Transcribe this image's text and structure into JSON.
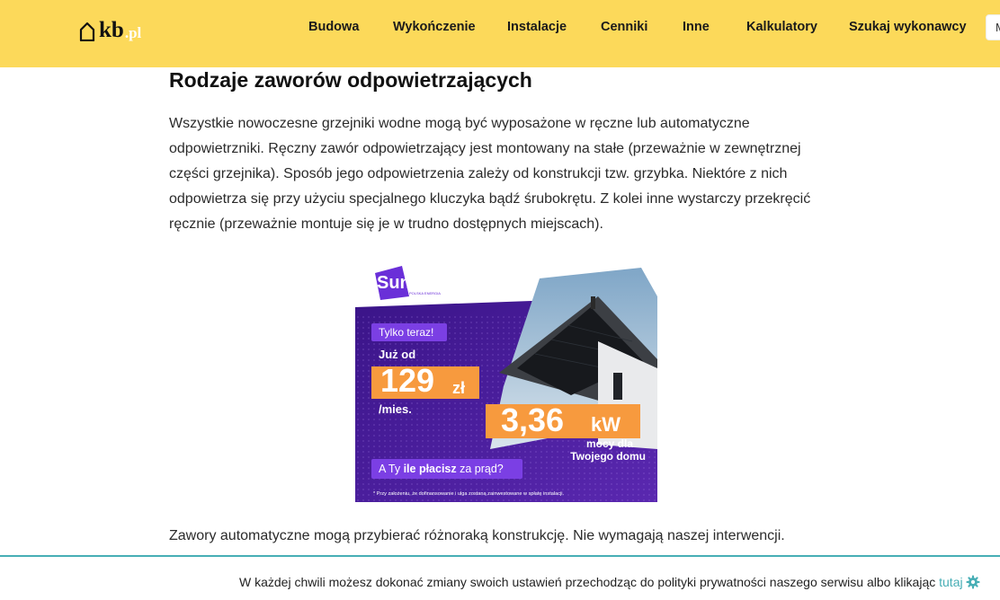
{
  "header": {
    "logo_kb": "kb",
    "logo_pl": ".pl",
    "nav": [
      "Budowa",
      "Wykończenie",
      "Instalacje",
      "Cenniki",
      "Inne",
      "Kalkulatory",
      "Szukaj wykonawcy"
    ],
    "nav_button_initial": "M"
  },
  "article": {
    "heading": "Rodzaje zaworów odpowietrzających",
    "paragraph1": "Wszystkie nowoczesne grzejniki wodne mogą być wyposażone w ręczne lub automatyczne odpowietrzniki. Ręczny zawór odpowietrzający jest montowany na stałe (przeważnie w zewnętrznej części grzejnika). Sposób jego odpowietrzenia zależy od konstrukcji tzw. grzybka. Niektóre z nich odpowietrza się przy użyciu specjalnego kluczyka bądź śrubokrętu. Z kolei inne wystarczy przekręcić ręcznie (przeważnie montuje się je w trudno dostępnych miejscach).",
    "paragraph2": "Zawory automatyczne mogą przybierać różnoraką konstrukcję. Nie wymagają naszej interwencji."
  },
  "ad": {
    "brand": "Sunday",
    "brand_sub": "POLSKA ENERGIA",
    "badge": "Tylko teraz!",
    "from_label": "Już od",
    "price": "129",
    "currency": "zł",
    "per_month": "/mies.",
    "power": "3,36",
    "power_unit": "kW",
    "power_caption_1": "mocy dla",
    "power_caption_2": "Twojego domu",
    "question_pre": "A Ty ",
    "question_bold": "ile płacisz",
    "question_post": " za prąd?",
    "footnote": "* Przy założeniu, że dofinansowanie i ulga zostaną zainwestowane w spłatę instalacji."
  },
  "cookie": {
    "text": "W każdej chwili możesz dokonać zmiany swoich ustawień przechodząc do polityki prywatności naszego serwisu albo klikając ",
    "link": "tutaj"
  },
  "colors": {
    "header_bg": "#fcd95a",
    "ad_purple": "#4b1f9e",
    "ad_orange": "#f79a3e",
    "cookie_accent": "#47aeb5"
  }
}
